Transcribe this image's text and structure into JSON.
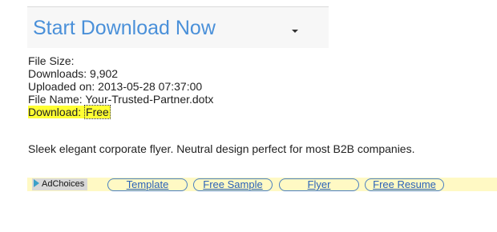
{
  "download_panel": {
    "title": "Start Download Now",
    "caret_icon": "caret-down-icon"
  },
  "file_info": {
    "file_size": "File Size:",
    "downloads": "Downloads: 9,902",
    "uploaded": "Uploaded on: 2013-05-28 07:37:00",
    "file_name": "File Name: Your-Trusted-Partner.dotx",
    "download_label": "Download:",
    "download_link": "Free"
  },
  "description": "Sleek elegant corporate flyer. Neutral design perfect for most B2B companies.",
  "ad_bar": {
    "adchoices_label": "AdChoices",
    "adchoices_icon": "adchoices-icon",
    "links": [
      "Template",
      "Free Sample",
      "Flyer",
      "Free Resume"
    ]
  },
  "colors": {
    "title_blue": "#4a90d9",
    "highlight_yellow": "#ffff33",
    "ad_bar_bg": "#fff9c4",
    "link_blue": "#2a62b8"
  }
}
